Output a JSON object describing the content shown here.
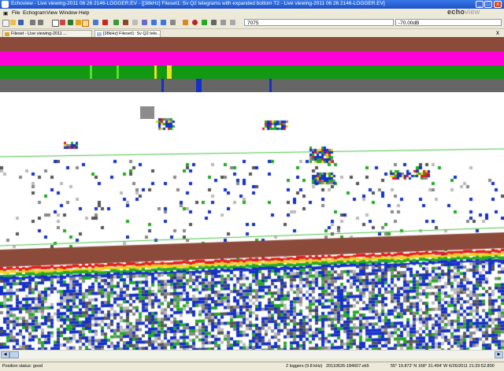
{
  "window": {
    "title": "Echoview - Live viewing-2011 06 26 2146-LOGGER.EV - [[38kHz] Fileset1: Sv Q2 telegrams with expanded bottom T2 - Live viewing-2011 06 26 2146-LOGGER.EV]",
    "minimize": "_",
    "maximize": "□",
    "close": "x"
  },
  "menu": {
    "file": "File",
    "echogram": "Echogram",
    "view": "View",
    "window": "Window",
    "help": "Help"
  },
  "brand": {
    "bold": "echo",
    "light": "view"
  },
  "toolbar": {
    "ping_value": "7075",
    "threshold_value": "-70.00dB"
  },
  "tabs": [
    {
      "label": "Fileset - Live viewing-2011 ..."
    },
    {
      "label": "[38kHz] Fileset1: Sv Q2 tele..."
    }
  ],
  "doc_close": "x",
  "echogram": {
    "colors": {
      "line1": "#8b4a3a",
      "line2": "#ff00d8",
      "line3": "#119911",
      "line4": "#666666",
      "bottom": "#8b4a3a",
      "threshold_line": "#46c246"
    }
  },
  "status": {
    "position": "Position status: good",
    "loggers": "2 loggers (9.8 kHz)",
    "file": "20110626-184607.ek5",
    "coords": "55° 19.872' N 168° 31.494' W",
    "datetime": "6/26/2011 21:29:52.800"
  }
}
